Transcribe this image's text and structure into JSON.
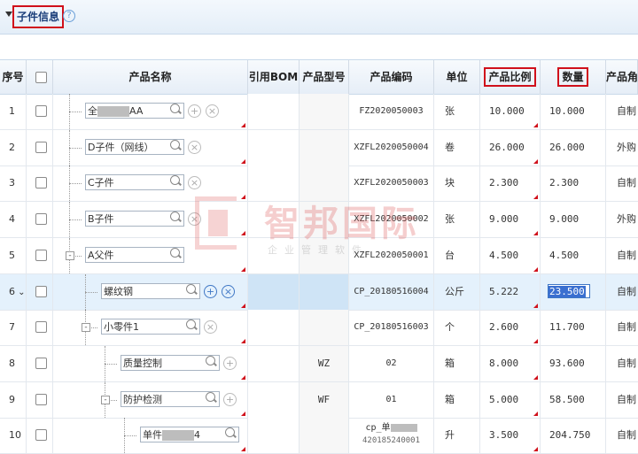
{
  "header": {
    "title": "子件信息",
    "help_icon": "?"
  },
  "columns": [
    "序号",
    "",
    "产品名称",
    "引用BOM",
    "产品型号",
    "产品编码",
    "单位",
    "产品比例",
    "数量",
    "产品角"
  ],
  "rows": [
    {
      "num": "1",
      "name": "全",
      "name_tail": "AA",
      "model": "",
      "code": "FZ2020050003",
      "unit": "张",
      "ratio": "10.000",
      "qty": "10.000",
      "type": "自制"
    },
    {
      "num": "2",
      "name": "D子件（网线）",
      "name_tail": "",
      "model": "",
      "code": "XZFL2020050004",
      "unit": "卷",
      "ratio": "26.000",
      "qty": "26.000",
      "type": "外购"
    },
    {
      "num": "3",
      "name": "C子件",
      "name_tail": "",
      "model": "",
      "code": "XZFL2020050003",
      "unit": "块",
      "ratio": "2.300",
      "qty": "2.300",
      "type": "自制"
    },
    {
      "num": "4",
      "name": "B子件",
      "name_tail": "",
      "model": "",
      "code": "XZFL2020050002",
      "unit": "张",
      "ratio": "9.000",
      "qty": "9.000",
      "type": "外购"
    },
    {
      "num": "5",
      "name": "A父件",
      "name_tail": "",
      "model": "",
      "code": "XZFL2020050001",
      "unit": "台",
      "ratio": "4.500",
      "qty": "4.500",
      "type": "自制"
    },
    {
      "num": "6",
      "name": "螺纹钢",
      "name_tail": "",
      "model": "",
      "code": "CP_20180516004",
      "unit": "公斤",
      "ratio": "5.222",
      "qty": "23.500",
      "type": "自制"
    },
    {
      "num": "7",
      "name": "小零件1",
      "name_tail": "",
      "model": "",
      "code": "CP_20180516003",
      "unit": "个",
      "ratio": "2.600",
      "qty": "11.700",
      "type": "自制"
    },
    {
      "num": "8",
      "name": "质量控制",
      "name_tail": "",
      "model": "WZ",
      "code": "02",
      "unit": "箱",
      "ratio": "8.000",
      "qty": "93.600",
      "type": "自制"
    },
    {
      "num": "9",
      "name": "防护检测",
      "name_tail": "",
      "model": "WF",
      "code": "01",
      "unit": "箱",
      "ratio": "5.000",
      "qty": "58.500",
      "type": "自制"
    },
    {
      "num": "10",
      "name": "单件",
      "name_tail": "4",
      "model": "",
      "code": "cp_单",
      "code2": "420185240001",
      "unit": "升",
      "ratio": "3.500",
      "qty": "204.750",
      "type": "自制"
    }
  ],
  "watermark": {
    "big": "智邦国际",
    "small": "企业管理软件"
  }
}
